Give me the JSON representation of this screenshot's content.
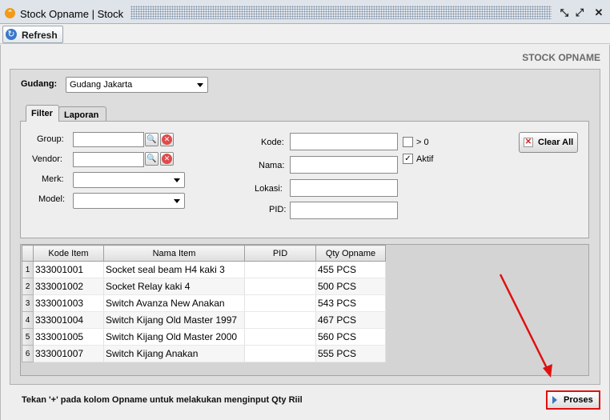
{
  "window": {
    "title": "Stock Opname | Stock"
  },
  "toolbar": {
    "refresh_label": "Refresh"
  },
  "page": {
    "heading": "STOCK OPNAME"
  },
  "gudang": {
    "label": "Gudang:",
    "value": "Gudang Jakarta"
  },
  "tabs": [
    {
      "label": "Filter",
      "active": true
    },
    {
      "label": "Laporan",
      "active": false
    }
  ],
  "filter": {
    "group_label": "Group:",
    "vendor_label": "Vendor:",
    "merk_label": "Merk:",
    "model_label": "Model:",
    "kode_label": "Kode:",
    "nama_label": "Nama:",
    "lokasi_label": "Lokasi:",
    "pid_label": "PID:",
    "gt_zero_label": "> 0",
    "gt_zero_checked": false,
    "aktif_label": "Aktif",
    "aktif_checked": true,
    "clear_all_label": "Clear All"
  },
  "table": {
    "columns": [
      "Kode Item",
      "Nama Item",
      "PID",
      "Qty Opname"
    ],
    "rows": [
      {
        "num": "1",
        "kode": "333001001",
        "nama": "Socket seal beam H4 kaki 3",
        "pid": "",
        "qty": "455 PCS"
      },
      {
        "num": "2",
        "kode": "333001002",
        "nama": "Socket Relay kaki 4",
        "pid": "",
        "qty": "500 PCS"
      },
      {
        "num": "3",
        "kode": "333001003",
        "nama": "Switch Avanza New Anakan",
        "pid": "",
        "qty": "543 PCS"
      },
      {
        "num": "4",
        "kode": "333001004",
        "nama": "Switch Kijang Old Master 1997",
        "pid": "",
        "qty": "467 PCS"
      },
      {
        "num": "5",
        "kode": "333001005",
        "nama": "Switch Kijang Old Master 2000",
        "pid": "",
        "qty": "560 PCS"
      },
      {
        "num": "6",
        "kode": "333001007",
        "nama": "Switch Kijang Anakan",
        "pid": "",
        "qty": "555 PCS"
      }
    ]
  },
  "footer": {
    "note": "Tekan '+' pada kolom Opname untuk melakukan menginput Qty Riil",
    "proses_label": "Proses"
  },
  "colors": {
    "highlight": "#e01010",
    "accent": "#3b77c0"
  }
}
